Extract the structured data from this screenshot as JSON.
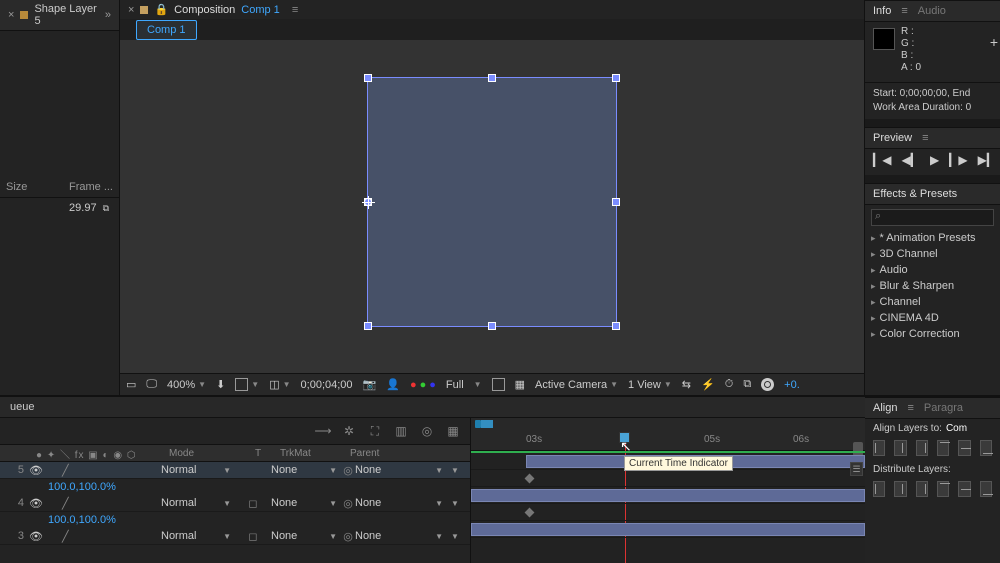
{
  "project": {
    "item_name": "Shape Layer 5",
    "cols": {
      "size": "Size",
      "frame": "Frame ..."
    },
    "framerate": "29.97"
  },
  "comp": {
    "tab_prefix": "Composition",
    "name": "Comp 1",
    "tab": "Comp 1"
  },
  "viewer_toolbar": {
    "zoom": "400%",
    "time": "0;00;04;00",
    "res": "Full",
    "camera": "Active Camera",
    "view": "1 View",
    "exposure": "+0."
  },
  "info": {
    "title": "Info",
    "audio": "Audio",
    "r": "R :",
    "g": "G :",
    "b": "B :",
    "a": "A : 0",
    "start": "Start: 0;00;00;00, End",
    "wad": "Work Area Duration: 0"
  },
  "preview": {
    "title": "Preview"
  },
  "effects": {
    "title": "Effects & Presets",
    "search_placeholder": "",
    "items": [
      "* Animation Presets",
      "3D Channel",
      "Audio",
      "Blur & Sharpen",
      "Channel",
      "CINEMA 4D",
      "Color Correction"
    ]
  },
  "timeline": {
    "tab": "ueue",
    "cols": {
      "mode": "Mode",
      "t": "T",
      "trkmat": "TrkMat",
      "parent": "Parent"
    },
    "row1": {
      "idx": "5",
      "mode": "Normal",
      "trk": "None",
      "parent": "None"
    },
    "prop1": "100.0,100.0%",
    "row2": {
      "idx": "4",
      "mode": "Normal",
      "trk": "None",
      "parent": "None"
    },
    "prop2": "100.0,100.0%",
    "row3": {
      "idx": "3",
      "mode": "Normal",
      "trk": "None",
      "parent": "None"
    },
    "ticks": {
      "t03": "03s",
      "t05": "05s",
      "t06": "06s"
    },
    "tooltip": "Current Time Indicator"
  },
  "align": {
    "tab": "Align",
    "tab2": "Paragra",
    "label": "Align Layers to:",
    "value": "Com",
    "dist": "Distribute Layers:"
  }
}
